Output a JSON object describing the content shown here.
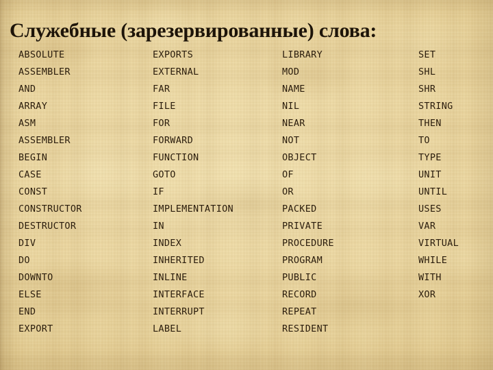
{
  "slide": {
    "title": "Служебные (зарезервированные) слова:",
    "background_color": "#e6d29a",
    "text_color": "#2a1c0c",
    "title_color": "#1d1409",
    "background_texture": "papyrus-linen-weave"
  },
  "keywords": {
    "columns": [
      {
        "index": 1,
        "items": [
          "ABSOLUTE",
          "ASSEMBLER",
          "AND",
          "ARRAY",
          "ASM",
          "ASSEMBLER",
          "BEGIN",
          "CASE",
          "CONST",
          "CONSTRUCTOR",
          "DESTRUCTOR",
          "DIV",
          "DO",
          "DOWNTO",
          "ELSE",
          "END",
          "EXPORT"
        ]
      },
      {
        "index": 2,
        "items": [
          "EXPORTS",
          "EXTERNAL",
          "FAR",
          "FILE",
          "FOR",
          "FORWARD",
          "FUNCTION",
          "GOTO",
          "IF",
          "IMPLEMENTATION",
          "IN",
          "INDEX",
          "INHERITED",
          "INLINE",
          "INTERFACE",
          "INTERRUPT",
          "LABEL"
        ]
      },
      {
        "index": 3,
        "items": [
          "LIBRARY",
          "MOD",
          "NAME",
          "NIL",
          "NEAR",
          "NOT",
          "OBJECT",
          "OF",
          "OR",
          "PACKED",
          "PRIVATE",
          "PROCEDURE",
          "PROGRAM",
          "PUBLIC",
          "RECORD",
          "REPEAT",
          "RESIDENT"
        ]
      },
      {
        "index": 4,
        "items": [
          "SET",
          "SHL",
          "SHR",
          "STRING",
          "THEN",
          "TO",
          "TYPE",
          "UNIT",
          "UNTIL",
          "USES",
          "VAR",
          "VIRTUAL",
          "WHILE",
          "WITH",
          "XOR"
        ]
      }
    ]
  }
}
